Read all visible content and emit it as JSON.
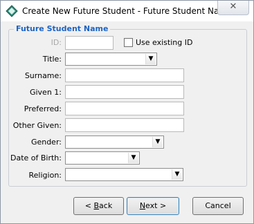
{
  "window": {
    "title": "Create New Future Student - Future Student Name",
    "close_glyph": "✕",
    "icon": "app-diamond-icon"
  },
  "group": {
    "legend": "Future Student Name"
  },
  "fields": {
    "id": {
      "label": "ID:",
      "value": ""
    },
    "use_existing_id": {
      "label": "Use existing ID",
      "checked": false
    },
    "title": {
      "label": "Title:",
      "value": ""
    },
    "surname": {
      "label": "Surname:",
      "value": ""
    },
    "given1": {
      "label": "Given 1:",
      "value": ""
    },
    "preferred": {
      "label": "Preferred:",
      "value": ""
    },
    "other_given": {
      "label": "Other Given:",
      "value": ""
    },
    "gender": {
      "label": "Gender:",
      "value": ""
    },
    "dob": {
      "label": "Date of Birth:",
      "value": ""
    },
    "religion": {
      "label": "Religion:",
      "value": ""
    }
  },
  "buttons": {
    "back": {
      "pre": "< ",
      "hotkey": "B",
      "post": "ack"
    },
    "next": {
      "pre": "",
      "hotkey": "N",
      "post": "ext >"
    },
    "cancel": {
      "label": "Cancel"
    }
  },
  "colors": {
    "legend": "#1c63c4",
    "window_bg": "#f0f0f0",
    "default_button_border": "#3c7fb1"
  }
}
